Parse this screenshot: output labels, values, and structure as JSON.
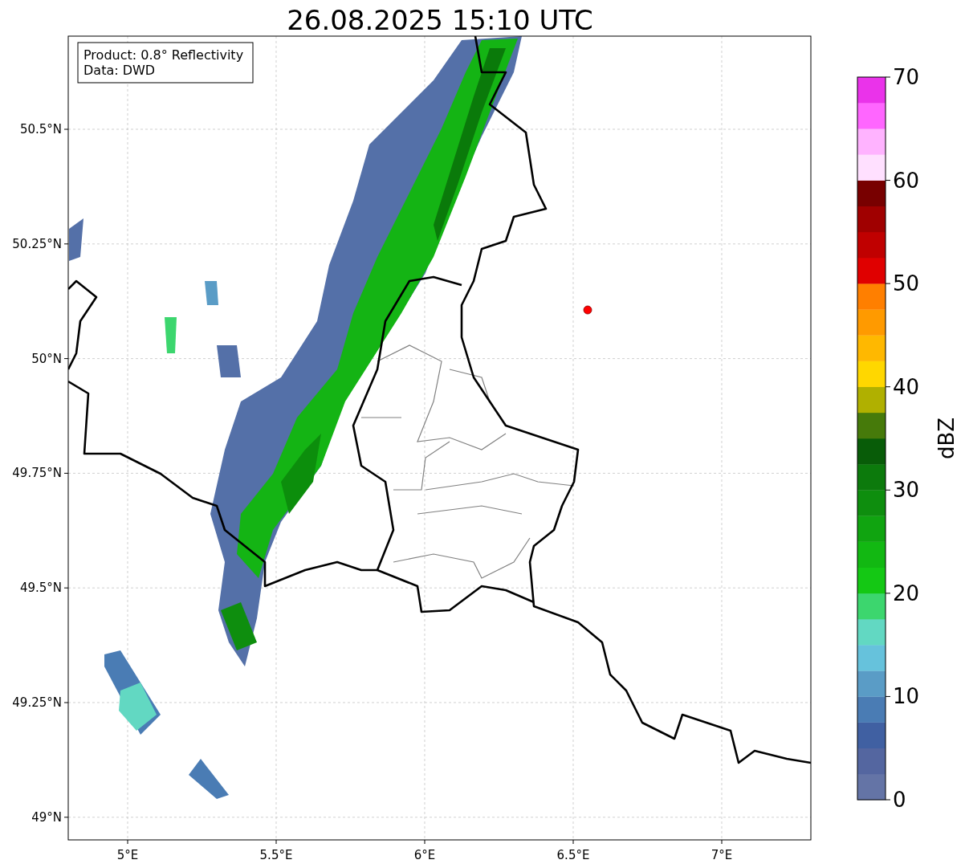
{
  "title": "26.08.2025 15:10 UTC",
  "map": {
    "annotation": [
      "Product: 0.8° Reflectivity",
      "Data: DWD"
    ],
    "xticks": [
      "5°E",
      "5.5°E",
      "6°E",
      "6.5°E",
      "7°E"
    ],
    "yticks": [
      "50.5°N",
      "50.25°N",
      "50°N",
      "49.75°N",
      "49.5°N",
      "49.25°N",
      "49°N"
    ]
  },
  "colorbar": {
    "label": "dBZ",
    "ticks": [
      "70",
      "60",
      "50",
      "40",
      "30",
      "20",
      "10",
      "0"
    ],
    "segments": [
      {
        "color": "#6474a6"
      },
      {
        "color": "#5466a0"
      },
      {
        "color": "#4060a2"
      },
      {
        "color": "#4a7cb4"
      },
      {
        "color": "#5a9cc6"
      },
      {
        "color": "#66c2dc"
      },
      {
        "color": "#62d8c2"
      },
      {
        "color": "#3cd66e"
      },
      {
        "color": "#14c814"
      },
      {
        "color": "#12b812"
      },
      {
        "color": "#10a410"
      },
      {
        "color": "#0e8e0e"
      },
      {
        "color": "#0c7a0c"
      },
      {
        "color": "#085c08"
      },
      {
        "color": "#467a0a"
      },
      {
        "color": "#b0b000"
      },
      {
        "color": "#ffd700"
      },
      {
        "color": "#ffb800"
      },
      {
        "color": "#ff9a00"
      },
      {
        "color": "#ff7f00"
      },
      {
        "color": "#e00000"
      },
      {
        "color": "#c00000"
      },
      {
        "color": "#a00000"
      },
      {
        "color": "#780000"
      },
      {
        "color": "#ffe0ff"
      },
      {
        "color": "#ffb3ff"
      },
      {
        "color": "#ff66ff"
      },
      {
        "color": "#ea33ea"
      }
    ]
  }
}
